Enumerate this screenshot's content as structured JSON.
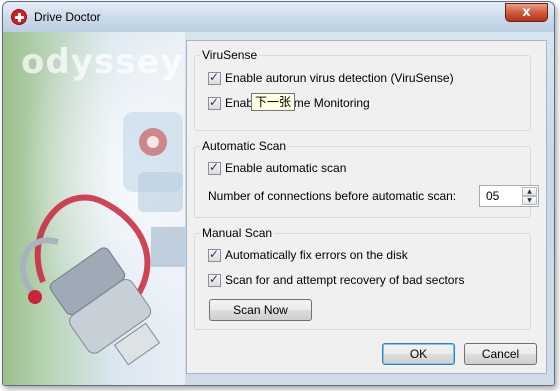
{
  "window": {
    "title": "Drive Doctor",
    "close_glyph": "x"
  },
  "art": {
    "logo_text": "odyssey"
  },
  "virusense": {
    "title": "ViruSense",
    "autorun_label": "Enable autorun virus detection (ViruSense)",
    "autorun_checked": true,
    "realtime_label_start": "Enab",
    "realtime_label_end": "ime Monitoring",
    "realtime_checked": true,
    "tooltip": "下一张"
  },
  "automatic_scan": {
    "title": "Automatic Scan",
    "enable_label": "Enable automatic scan",
    "enable_checked": true,
    "connections_label": "Number of connections before automatic scan:",
    "connections_value": "05"
  },
  "manual_scan": {
    "title": "Manual Scan",
    "fix_label": "Automatically fix errors on the disk",
    "fix_checked": true,
    "recover_label": "Scan for and attempt recovery of bad sectors",
    "recover_checked": true,
    "scan_now_label": "Scan Now"
  },
  "footer": {
    "ok_label": "OK",
    "cancel_label": "Cancel"
  },
  "icons": {
    "check": "✓",
    "spin_up": "▲",
    "spin_down": "▼"
  },
  "colors": {
    "close_button": "#c3452b",
    "app_icon": "#d21f24",
    "tooltip_bg": "#ffffe1"
  }
}
